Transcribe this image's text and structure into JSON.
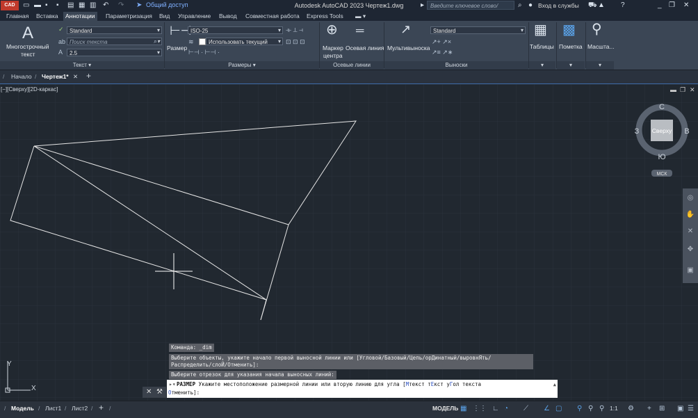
{
  "titlebar": {
    "app_logo": "CAD",
    "share_label": "Общий доступ",
    "title": "Autodesk AutoCAD 2023    Чертеж1.dwg",
    "search_placeholder": "Введите ключевое слово/фразу",
    "signin_label": "Вход в службы"
  },
  "menu_tabs": [
    "Главная",
    "Вставка",
    "Аннотации",
    "Параметризация",
    "Вид",
    "Управление",
    "Вывод",
    "Совместная работа",
    "Express Tools"
  ],
  "ribbon": {
    "text_panel": {
      "title": "Текст",
      "mtext_label_1": "Многострочный",
      "mtext_label_2": "текст",
      "style": "Standard",
      "search_placeholder": "Поиск текста",
      "height": "2.5"
    },
    "dims_panel": {
      "title": "Размеры",
      "dim_label": "Размер",
      "style": "ISO-25",
      "layer": "Использовать текущий"
    },
    "centerlines_panel": {
      "title": "Осевые линии",
      "center_mark_1": "Маркер",
      "center_mark_2": "центра",
      "centerline": "Осевая линия"
    },
    "leaders_panel": {
      "title": "Выноски",
      "multileader": "Мультивыноска",
      "style": "Standard"
    },
    "tables_label": "Таблицы",
    "markup_label": "Пометка",
    "scale_label": "Масшта..."
  },
  "file_tabs": {
    "start": "Начало",
    "drawing": "Чертеж1*"
  },
  "viewport": {
    "label": "[−][Сверху][2D-каркас]",
    "viewcube_top": "Сверху",
    "compass_n": "С",
    "compass_s": "Ю",
    "compass_w": "З",
    "compass_e": "В",
    "ucs_label": "МСК",
    "axis_y": "Y",
    "axis_x": "X"
  },
  "command": {
    "history_1": "Команда: _dim",
    "history_2a": "Выберите объекты, укажите начало первой выносной линии или [Угловой/Базовый/Цепь/орДинатный/выровнЯть/",
    "history_2b": "Распределить/слоЙ/Отменить]:",
    "history_3": "Выберите отрезок для указания начала выносных линий:",
    "prompt_cmd": "РАЗМЕР",
    "prompt_text": "Укажите местоположение размерной линии или вторую линию для угла [",
    "opt1": "М",
    "opt1_rest": "текст ",
    "opt2": "т",
    "opt2_mid": "Е",
    "opt2_rest": "кст ",
    "opt3": "у",
    "opt3_mid": "Г",
    "opt3_rest": "ол текста",
    "line2_opt": "О",
    "line2_rest": "тменить]:"
  },
  "status": {
    "model_tab": "Модель",
    "layout1": "Лист1",
    "layout2": "Лист2",
    "model_label": "МОДЕЛЬ",
    "scale": "1:1"
  }
}
